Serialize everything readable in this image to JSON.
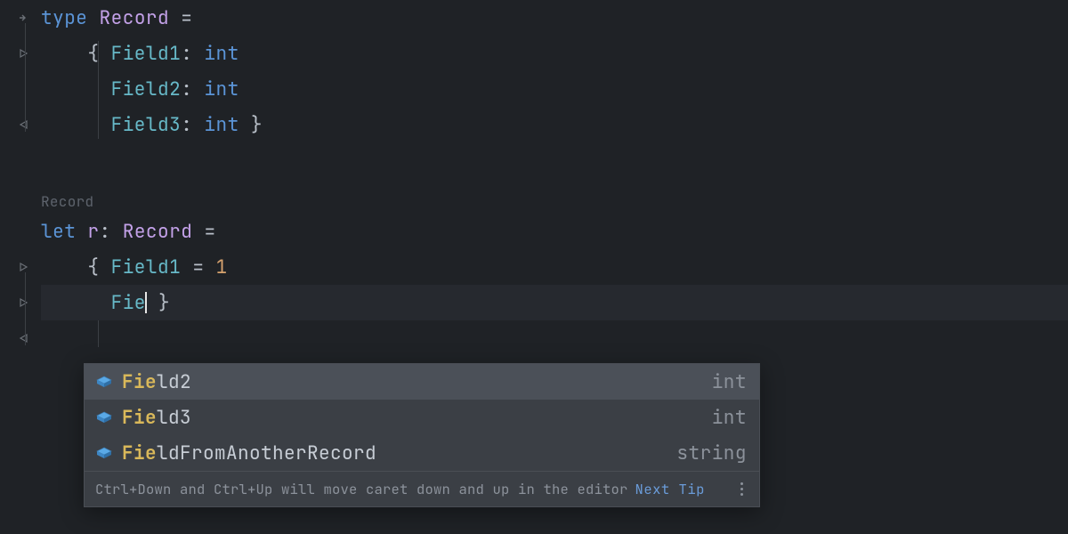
{
  "code": {
    "l1": {
      "kw": "type",
      "name": "Record",
      "op": " ="
    },
    "l2": {
      "indent": "    ",
      "brace": "{ ",
      "field": "Field1",
      "colon": ": ",
      "type": "int"
    },
    "l3": {
      "indent": "      ",
      "field": "Field2",
      "colon": ": ",
      "type": "int"
    },
    "l4": {
      "indent": "      ",
      "field": "Field3",
      "colon": ": ",
      "type": "int",
      "close": " }"
    },
    "inlay": "Record",
    "l7": {
      "kw": "let",
      "sp": " ",
      "name": "r",
      "colon": ": ",
      "type": "Record",
      "op": " ="
    },
    "l8": {
      "indent": "    ",
      "brace": "{ ",
      "field": "Field1",
      "eq": " = ",
      "val": "1"
    },
    "l9": {
      "indent": "      ",
      "typed": "Fie",
      "close": " }"
    }
  },
  "popup": {
    "items": [
      {
        "match": "Fie",
        "rest": "ld2",
        "type": "int",
        "selected": true
      },
      {
        "match": "Fie",
        "rest": "ld3",
        "type": "int",
        "selected": false
      },
      {
        "match": "Fie",
        "rest": "ldFromAnotherRecord",
        "type": "string",
        "selected": false
      }
    ],
    "footer_msg": "Ctrl+Down and Ctrl+Up will move caret down and up in the editor",
    "footer_link": "Next Tip"
  }
}
